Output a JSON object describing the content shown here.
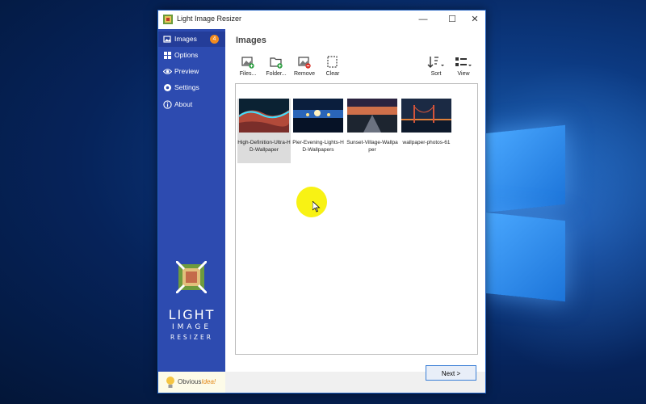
{
  "window": {
    "title": "Light Image Resizer",
    "controls": {
      "minimize": "—",
      "maximize": "☐",
      "close": "✕"
    }
  },
  "sidebar": {
    "items": [
      {
        "label": "Images",
        "icon": "images-icon",
        "badge": "4",
        "active": true
      },
      {
        "label": "Options",
        "icon": "options-icon"
      },
      {
        "label": "Preview",
        "icon": "eye-icon"
      },
      {
        "label": "Settings",
        "icon": "gear-icon"
      },
      {
        "label": "About",
        "icon": "info-icon"
      }
    ],
    "brand": {
      "line1": "LIGHT",
      "line2": "IMAGE",
      "line3": "RESIZER"
    },
    "company": {
      "part1": "Obvious",
      "part2": "Idea!"
    }
  },
  "main": {
    "title": "Images",
    "toolbar": {
      "files": "Files...",
      "folder": "Folder...",
      "remove": "Remove",
      "clear": "Clear",
      "sort": "Sort",
      "view": "View"
    },
    "images": [
      {
        "caption": "High-Definition-Ultra-HD-Wallpaper",
        "selected": true
      },
      {
        "caption": "Pier-Evening-Lights-HD-Wallpapers"
      },
      {
        "caption": "Sunset-Village-Wallpaper"
      },
      {
        "caption": "wallpaper-photos-61"
      }
    ]
  },
  "footer": {
    "next_label": "Next >"
  },
  "colors": {
    "sidebar": "#2d4bb0",
    "badge": "#f28b1e",
    "accent": "#3b7fd6"
  }
}
